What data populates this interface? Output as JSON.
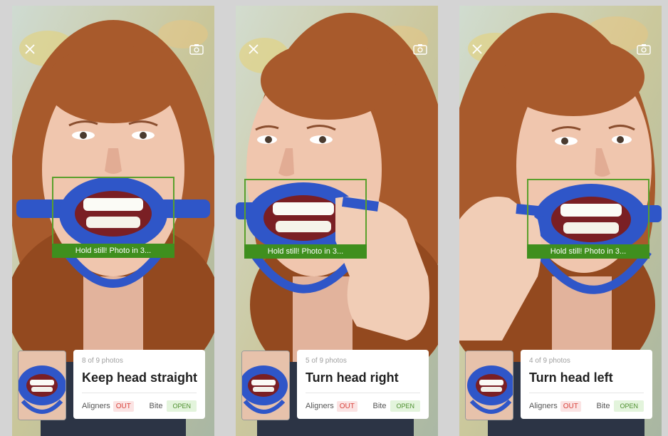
{
  "screens": [
    {
      "count": "8 of 9 photos",
      "title": "Keep head straight",
      "aligners_label": "Aligners",
      "aligners_status": "OUT",
      "bite_label": "Bite",
      "bite_status": "OPEN",
      "overlay_text": "Hold still! Photo in 3..."
    },
    {
      "count": "5 of 9 photos",
      "title": "Turn head right",
      "aligners_label": "Aligners",
      "aligners_status": "OUT",
      "bite_label": "Bite",
      "bite_status": "OPEN",
      "overlay_text": "Hold still! Photo in 3..."
    },
    {
      "count": "4 of 9 photos",
      "title": "Turn head left",
      "aligners_label": "Aligners",
      "aligners_status": "OUT",
      "bite_label": "Bite",
      "bite_status": "OPEN",
      "overlay_text": "Hold still! Photo in 3..."
    }
  ],
  "icons": {
    "close": "close-icon",
    "camera": "camera-switch-icon"
  },
  "colors": {
    "frame_green": "#5aa02c",
    "banner_green": "#3f8f1e",
    "retractor_blue": "#2f56c8",
    "out_red": "#d8453e",
    "open_green": "#4d8f2e"
  }
}
